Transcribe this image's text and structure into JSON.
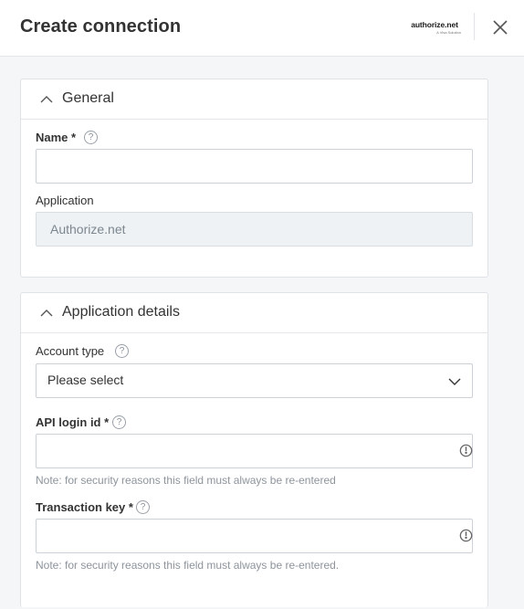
{
  "header": {
    "title": "Create connection",
    "logo_main": "authorize.net",
    "logo_sub": "A Visa Solution",
    "close_icon": "close-icon"
  },
  "general": {
    "title": "General",
    "name_label": "Name *",
    "name_help": "?",
    "name_value": "",
    "application_label": "Application",
    "application_value": "Authorize.net"
  },
  "details": {
    "title": "Application details",
    "account_type_label": "Account type",
    "account_type_help": "?",
    "account_type_value": "Please select",
    "api_login_label": "API login id *",
    "api_login_help": "?",
    "api_login_value": "",
    "api_login_note": "Note: for security reasons this field must always be re-entered",
    "transaction_key_label": "Transaction key *",
    "transaction_key_help": "?",
    "transaction_key_value": "",
    "transaction_key_note": "Note: for security reasons this field must always be re-entered."
  },
  "colors": {
    "border": "#dfe2e6",
    "readonly_bg": "#eef2f4",
    "note_text": "#8d949c"
  }
}
